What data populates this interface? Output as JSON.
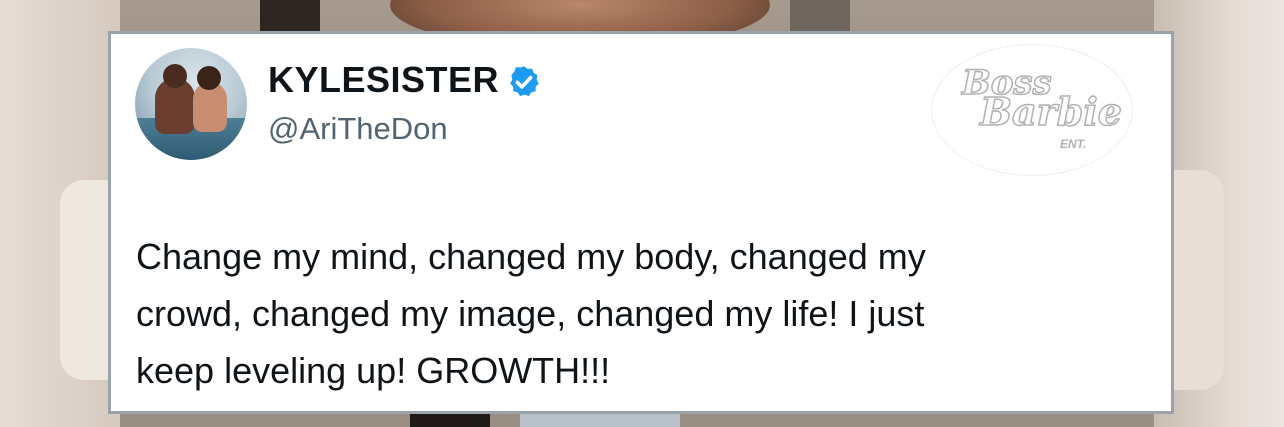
{
  "tweet": {
    "display_name": "KYLESISTER",
    "handle": "@AriTheDon",
    "text": "Change my mind, changed my body, changed my\ncrowd, changed my image, changed my life! I just\nkeep leveling up! GROWTH!!!",
    "avatar_icon": "profile-photo",
    "verified_icon": "verified-badge-icon",
    "verified_color": "#1d9bf0"
  },
  "watermark": {
    "line1": "Boss",
    "line2": "Barbie",
    "line3": "ENT."
  }
}
